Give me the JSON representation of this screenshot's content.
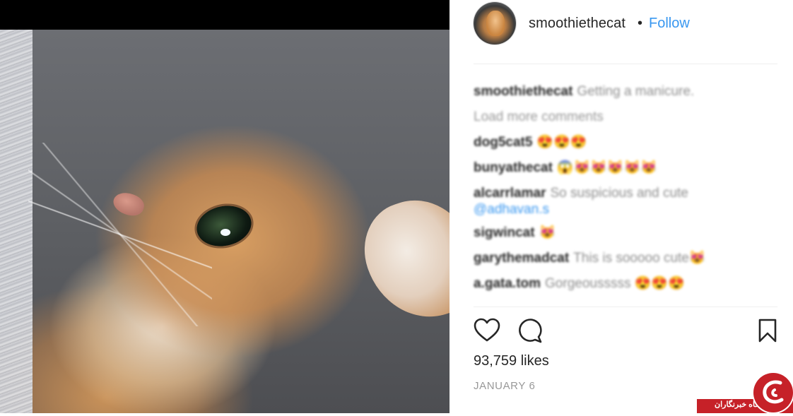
{
  "post": {
    "username": "smoothiethecat",
    "separator": "•",
    "follow_label": "Follow",
    "caption": {
      "author": "smoothiethecat",
      "text": "Getting a manicure."
    },
    "load_more_label": "Load more comments",
    "comments": [
      {
        "author": "dog5cat5",
        "text": "😍😍😍"
      },
      {
        "author": "bunyathecat",
        "text": "😱😻😻😻😻😻"
      },
      {
        "author": "alcarrlamar",
        "text": "So suspicious and cute",
        "mention": "@adhavan.s"
      },
      {
        "author": "sigwincat",
        "text": "😻"
      },
      {
        "author": "garythemadcat",
        "text": "This is sooooo cute😻"
      },
      {
        "author": "a.gata.tom",
        "text": "Gorgeousssss 😍😍😍"
      }
    ],
    "likes": "93,759 likes",
    "date": "JANUARY 6"
  },
  "icons": {
    "like": "heart-icon",
    "comment": "comment-bubble-icon",
    "save": "bookmark-icon"
  },
  "watermark": {
    "text": "باشگاه خبرنگاران"
  },
  "colors": {
    "follow": "#3897f0",
    "text": "#262626",
    "muted": "#999999",
    "watermark": "#c62128"
  }
}
